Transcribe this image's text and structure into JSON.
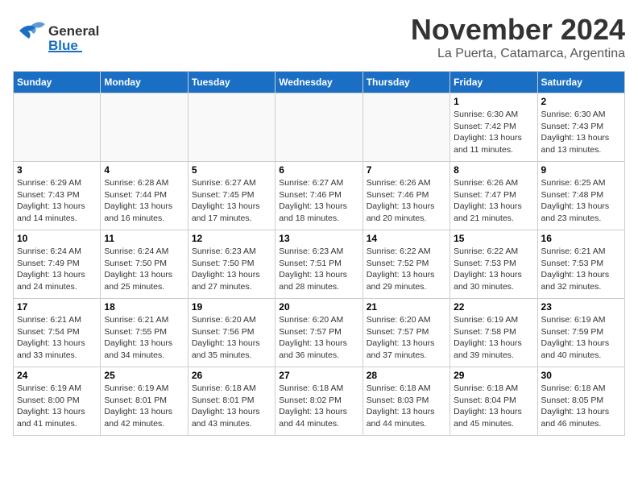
{
  "header": {
    "logo_general": "General",
    "logo_blue": "Blue",
    "title": "November 2024",
    "subtitle": "La Puerta, Catamarca, Argentina"
  },
  "days_of_week": [
    "Sunday",
    "Monday",
    "Tuesday",
    "Wednesday",
    "Thursday",
    "Friday",
    "Saturday"
  ],
  "weeks": [
    [
      {
        "day": "",
        "detail": ""
      },
      {
        "day": "",
        "detail": ""
      },
      {
        "day": "",
        "detail": ""
      },
      {
        "day": "",
        "detail": ""
      },
      {
        "day": "",
        "detail": ""
      },
      {
        "day": "1",
        "detail": "Sunrise: 6:30 AM\nSunset: 7:42 PM\nDaylight: 13 hours\nand 11 minutes."
      },
      {
        "day": "2",
        "detail": "Sunrise: 6:30 AM\nSunset: 7:43 PM\nDaylight: 13 hours\nand 13 minutes."
      }
    ],
    [
      {
        "day": "3",
        "detail": "Sunrise: 6:29 AM\nSunset: 7:43 PM\nDaylight: 13 hours\nand 14 minutes."
      },
      {
        "day": "4",
        "detail": "Sunrise: 6:28 AM\nSunset: 7:44 PM\nDaylight: 13 hours\nand 16 minutes."
      },
      {
        "day": "5",
        "detail": "Sunrise: 6:27 AM\nSunset: 7:45 PM\nDaylight: 13 hours\nand 17 minutes."
      },
      {
        "day": "6",
        "detail": "Sunrise: 6:27 AM\nSunset: 7:46 PM\nDaylight: 13 hours\nand 18 minutes."
      },
      {
        "day": "7",
        "detail": "Sunrise: 6:26 AM\nSunset: 7:46 PM\nDaylight: 13 hours\nand 20 minutes."
      },
      {
        "day": "8",
        "detail": "Sunrise: 6:26 AM\nSunset: 7:47 PM\nDaylight: 13 hours\nand 21 minutes."
      },
      {
        "day": "9",
        "detail": "Sunrise: 6:25 AM\nSunset: 7:48 PM\nDaylight: 13 hours\nand 23 minutes."
      }
    ],
    [
      {
        "day": "10",
        "detail": "Sunrise: 6:24 AM\nSunset: 7:49 PM\nDaylight: 13 hours\nand 24 minutes."
      },
      {
        "day": "11",
        "detail": "Sunrise: 6:24 AM\nSunset: 7:50 PM\nDaylight: 13 hours\nand 25 minutes."
      },
      {
        "day": "12",
        "detail": "Sunrise: 6:23 AM\nSunset: 7:50 PM\nDaylight: 13 hours\nand 27 minutes."
      },
      {
        "day": "13",
        "detail": "Sunrise: 6:23 AM\nSunset: 7:51 PM\nDaylight: 13 hours\nand 28 minutes."
      },
      {
        "day": "14",
        "detail": "Sunrise: 6:22 AM\nSunset: 7:52 PM\nDaylight: 13 hours\nand 29 minutes."
      },
      {
        "day": "15",
        "detail": "Sunrise: 6:22 AM\nSunset: 7:53 PM\nDaylight: 13 hours\nand 30 minutes."
      },
      {
        "day": "16",
        "detail": "Sunrise: 6:21 AM\nSunset: 7:53 PM\nDaylight: 13 hours\nand 32 minutes."
      }
    ],
    [
      {
        "day": "17",
        "detail": "Sunrise: 6:21 AM\nSunset: 7:54 PM\nDaylight: 13 hours\nand 33 minutes."
      },
      {
        "day": "18",
        "detail": "Sunrise: 6:21 AM\nSunset: 7:55 PM\nDaylight: 13 hours\nand 34 minutes."
      },
      {
        "day": "19",
        "detail": "Sunrise: 6:20 AM\nSunset: 7:56 PM\nDaylight: 13 hours\nand 35 minutes."
      },
      {
        "day": "20",
        "detail": "Sunrise: 6:20 AM\nSunset: 7:57 PM\nDaylight: 13 hours\nand 36 minutes."
      },
      {
        "day": "21",
        "detail": "Sunrise: 6:20 AM\nSunset: 7:57 PM\nDaylight: 13 hours\nand 37 minutes."
      },
      {
        "day": "22",
        "detail": "Sunrise: 6:19 AM\nSunset: 7:58 PM\nDaylight: 13 hours\nand 39 minutes."
      },
      {
        "day": "23",
        "detail": "Sunrise: 6:19 AM\nSunset: 7:59 PM\nDaylight: 13 hours\nand 40 minutes."
      }
    ],
    [
      {
        "day": "24",
        "detail": "Sunrise: 6:19 AM\nSunset: 8:00 PM\nDaylight: 13 hours\nand 41 minutes."
      },
      {
        "day": "25",
        "detail": "Sunrise: 6:19 AM\nSunset: 8:01 PM\nDaylight: 13 hours\nand 42 minutes."
      },
      {
        "day": "26",
        "detail": "Sunrise: 6:18 AM\nSunset: 8:01 PM\nDaylight: 13 hours\nand 43 minutes."
      },
      {
        "day": "27",
        "detail": "Sunrise: 6:18 AM\nSunset: 8:02 PM\nDaylight: 13 hours\nand 44 minutes."
      },
      {
        "day": "28",
        "detail": "Sunrise: 6:18 AM\nSunset: 8:03 PM\nDaylight: 13 hours\nand 44 minutes."
      },
      {
        "day": "29",
        "detail": "Sunrise: 6:18 AM\nSunset: 8:04 PM\nDaylight: 13 hours\nand 45 minutes."
      },
      {
        "day": "30",
        "detail": "Sunrise: 6:18 AM\nSunset: 8:05 PM\nDaylight: 13 hours\nand 46 minutes."
      }
    ]
  ]
}
